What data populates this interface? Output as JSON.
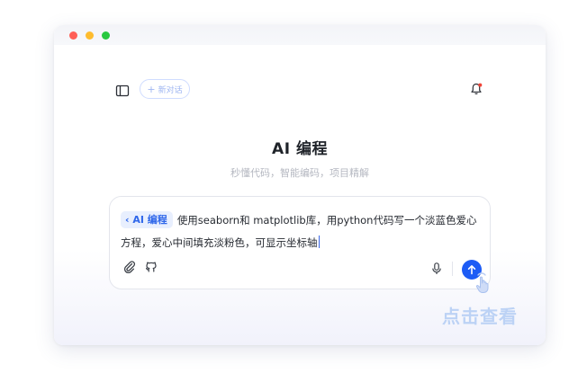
{
  "window": {
    "controls": [
      "close",
      "minimize",
      "maximize"
    ]
  },
  "header": {
    "sidebar_icon": "sidebar-toggle-icon",
    "new_chat_label": "新对话",
    "notification_icon": "bell-icon"
  },
  "main": {
    "title": "AI 编程",
    "subtitle": "秒懂代码，智能编码，项目精解"
  },
  "composer": {
    "tag_label": "AI 编程",
    "prompt_text": "使用seaborn和 matplotlib库，用python代码写一个淡蓝色爱心方程，爱心中间填充淡粉色，可显示坐标轴",
    "attach_icon": "paperclip-icon",
    "repo_icon": "github-icon",
    "mic_icon": "microphone-icon",
    "send_icon": "send-arrow-icon"
  },
  "overlay": {
    "cta_text": "点击查看",
    "pointer_icon": "hand-pointer-icon"
  },
  "colors": {
    "accent": "#1d5cf5",
    "tag_bg": "#e8effe",
    "tag_text": "#2f67ea",
    "cta": "#bcd2f5"
  }
}
